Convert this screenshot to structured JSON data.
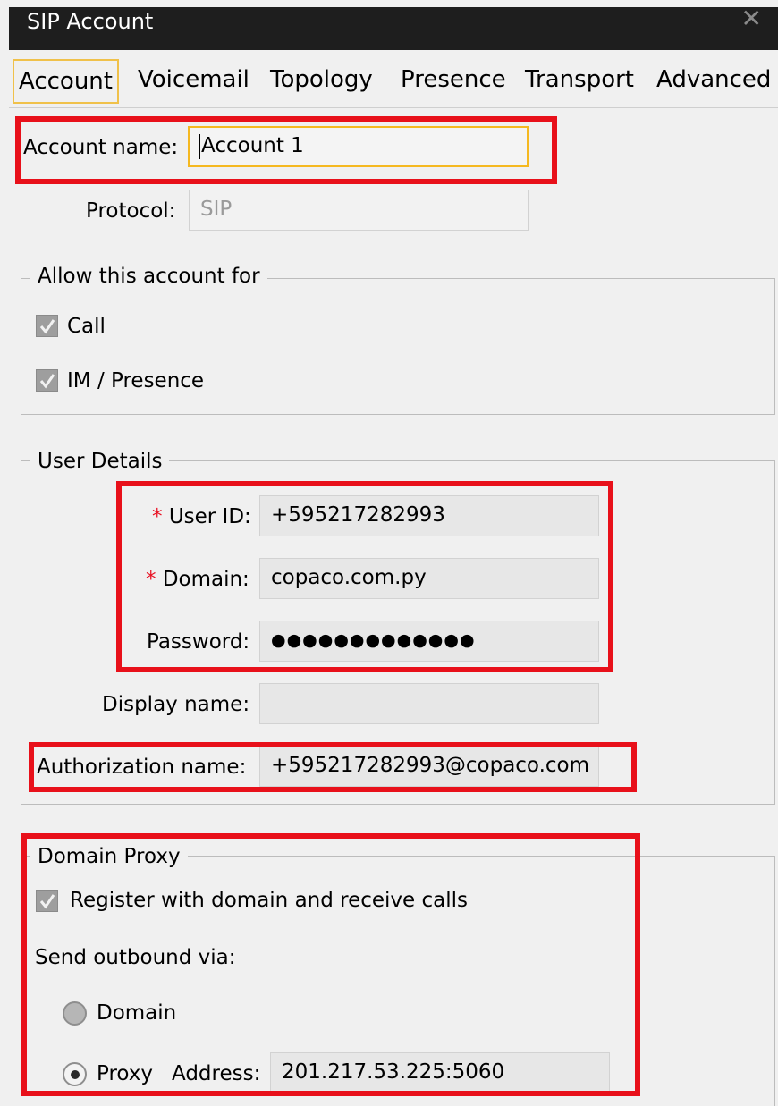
{
  "window": {
    "title": "SIP Account",
    "close_glyph": "✕"
  },
  "tabs": [
    {
      "label": "Account",
      "active": true
    },
    {
      "label": "Voicemail"
    },
    {
      "label": "Topology"
    },
    {
      "label": "Presence"
    },
    {
      "label": "Transport"
    },
    {
      "label": "Advanced"
    }
  ],
  "account": {
    "name_label": "Account name:",
    "name_value": "Account 1",
    "protocol_label": "Protocol:",
    "protocol_value": "SIP"
  },
  "allow": {
    "legend": "Allow this account for",
    "call_label": "Call",
    "call_checked": true,
    "im_label": "IM / Presence",
    "im_checked": true
  },
  "user_details": {
    "legend": "User Details",
    "required_mark": "*",
    "user_id_label": "User ID:",
    "user_id_value": "+595217282993",
    "domain_label": "Domain:",
    "domain_value": "copaco.com.py",
    "password_label": "Password:",
    "password_value": "●●●●●●●●●●●●●",
    "display_name_label": "Display name:",
    "display_name_value": "",
    "auth_name_label": "Authorization name:",
    "auth_name_value": "+595217282993@copaco.com"
  },
  "domain_proxy": {
    "legend": "Domain Proxy",
    "register_label": "Register with domain and receive calls",
    "register_checked": true,
    "send_outbound_label": "Send outbound via:",
    "domain_option": "Domain",
    "proxy_option": "Proxy",
    "address_label": "Address:",
    "address_value": "201.217.53.225:5060",
    "selected": "Proxy"
  },
  "colors": {
    "highlight": "#e8101a",
    "focus": "#f5b820",
    "titlebar": "#1e1e1e",
    "required": "#e81123"
  }
}
